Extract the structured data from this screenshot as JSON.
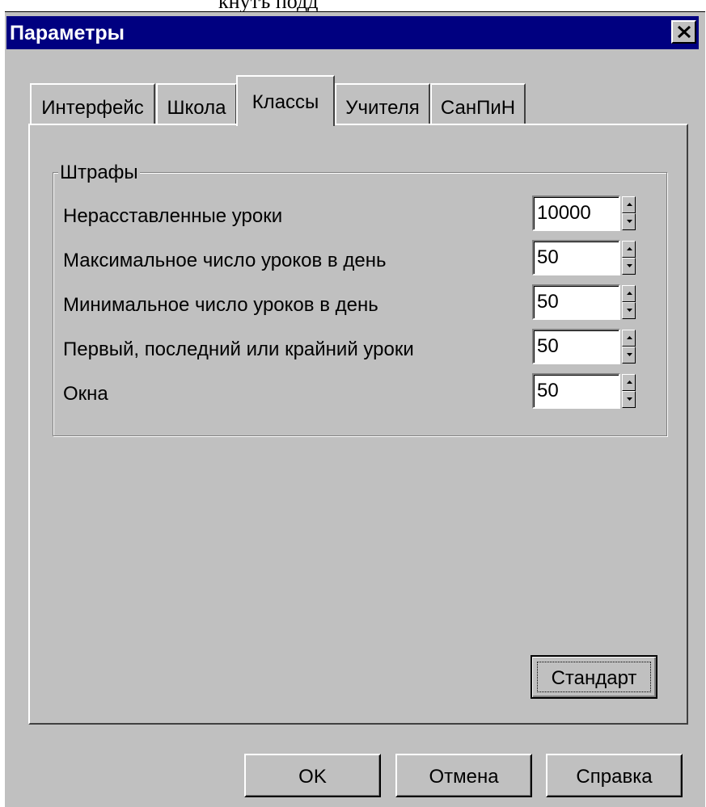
{
  "top_caption": "кнутъ подд",
  "window": {
    "title": "Параметры"
  },
  "tabs": [
    {
      "label": "Интерфейс",
      "active": false
    },
    {
      "label": "Школа",
      "active": false
    },
    {
      "label": "Классы",
      "active": true
    },
    {
      "label": "Учителя",
      "active": false
    },
    {
      "label": "СанПиН",
      "active": false
    }
  ],
  "group": {
    "title": "Штрафы",
    "rows": [
      {
        "label": "Нерасставленные уроки",
        "value": "10000"
      },
      {
        "label": "Максимальное число уроков в день",
        "value": "50"
      },
      {
        "label": "Минимальное число уроков в день",
        "value": "50"
      },
      {
        "label": "Первый, последний или крайний уроки",
        "value": "50"
      },
      {
        "label": "Окна",
        "value": "50"
      }
    ]
  },
  "standard_button": "Стандарт",
  "footer": {
    "ok": "OK",
    "cancel": "Отмена",
    "help": "Справка"
  },
  "icons": {
    "close": "close-icon",
    "spin_up": "arrow-up-icon",
    "spin_down": "arrow-down-icon"
  },
  "colors": {
    "titlebar": "#000080",
    "face": "#c0c0c0"
  }
}
